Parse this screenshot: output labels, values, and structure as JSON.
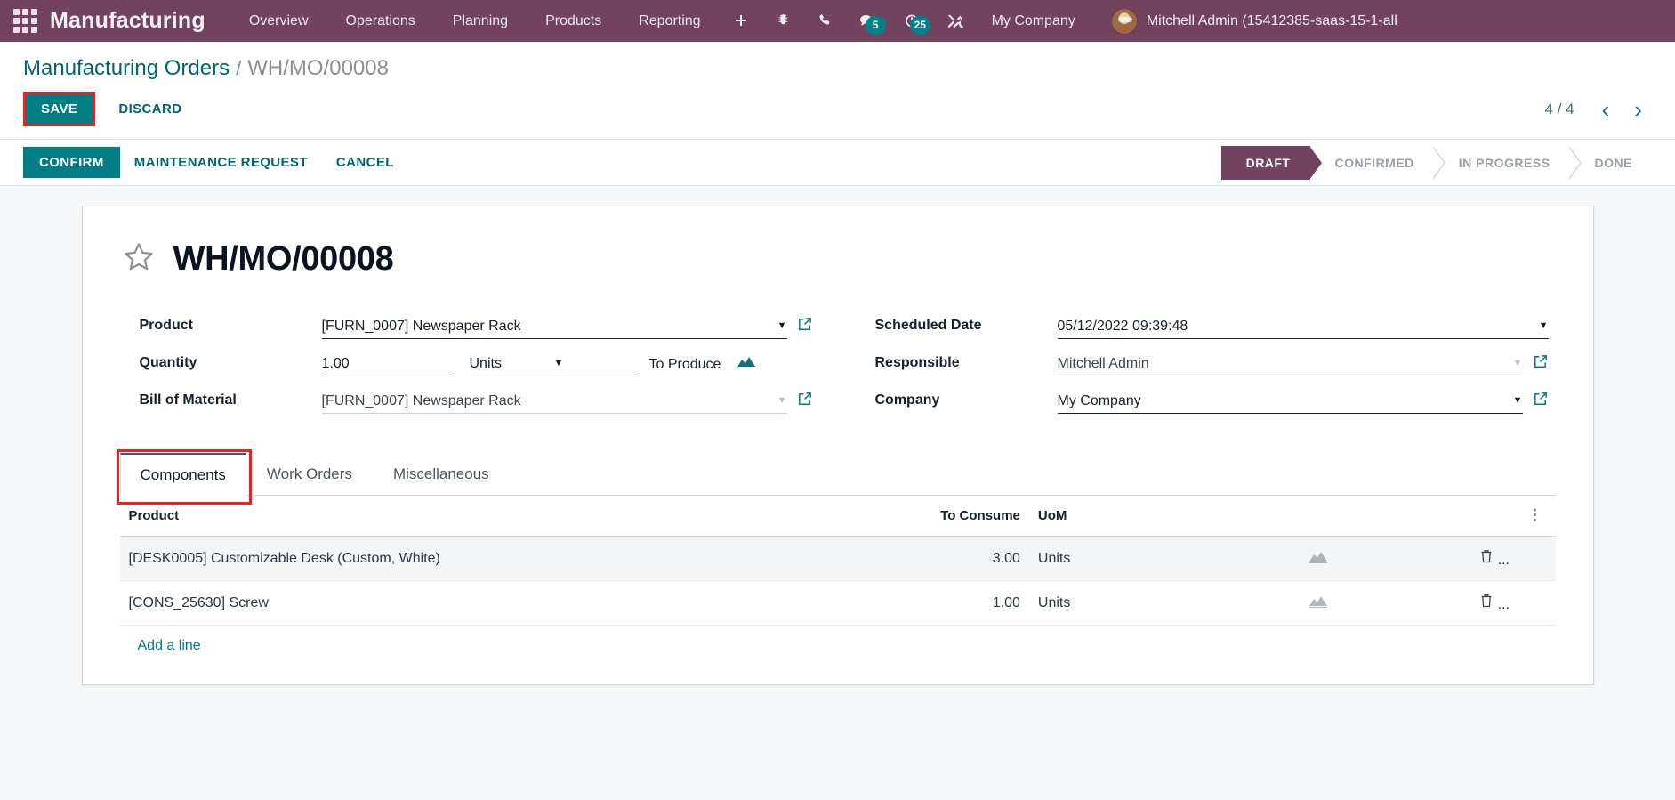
{
  "navbar": {
    "apps_icon": "apps-grid-icon",
    "brand": "Manufacturing",
    "menu": [
      {
        "label": "Overview"
      },
      {
        "label": "Operations"
      },
      {
        "label": "Planning"
      },
      {
        "label": "Products"
      },
      {
        "label": "Reporting"
      }
    ],
    "icons": [
      {
        "name": "plus-icon",
        "glyph": "+"
      },
      {
        "name": "bug-icon",
        "glyph": "bug"
      },
      {
        "name": "phone-icon",
        "glyph": "phone"
      },
      {
        "name": "messages-icon",
        "glyph": "chat",
        "badge": "5"
      },
      {
        "name": "activities-clock-icon",
        "glyph": "clock",
        "badge": "25"
      },
      {
        "name": "tools-icon",
        "glyph": "wrench"
      }
    ],
    "company": "My Company",
    "user": "Mitchell Admin (15412385-saas-15-1-all",
    "brand_color": "#71435f",
    "badge_color": "#00828c"
  },
  "breadcrumb": {
    "root": "Manufacturing Orders",
    "separator": "/",
    "current": "WH/MO/00008"
  },
  "edit_bar": {
    "save_label": "SAVE",
    "discard_label": "DISCARD",
    "save_highlight_color": "#f21f1f",
    "save_bg": "#017e84"
  },
  "pager": {
    "count": "4 / 4",
    "prev": "‹",
    "next": "›"
  },
  "action_bar": {
    "confirm_label": "CONFIRM",
    "maintenance_label": "MAINTENANCE REQUEST",
    "cancel_label": "CANCEL"
  },
  "statusbar": {
    "stages": [
      {
        "label": "DRAFT",
        "active": true
      },
      {
        "label": "CONFIRMED",
        "active": false
      },
      {
        "label": "IN PROGRESS",
        "active": false
      },
      {
        "label": "DONE",
        "active": false
      }
    ],
    "active_color": "#71435f"
  },
  "form": {
    "title": "WH/MO/00008",
    "star_icon": "star-outline-icon",
    "left": {
      "product_label": "Product",
      "product_value": "[FURN_0007] Newspaper Rack",
      "quantity_label": "Quantity",
      "quantity_value": "1.00",
      "uom_value": "Units",
      "to_produce_label": "To Produce",
      "bom_label": "Bill of Material",
      "bom_value": "[FURN_0007] Newspaper Rack"
    },
    "right": {
      "scheduled_label": "Scheduled Date",
      "scheduled_value": "05/12/2022 09:39:48",
      "responsible_label": "Responsible",
      "responsible_value": "Mitchell Admin",
      "company_label": "Company",
      "company_value": "My Company"
    }
  },
  "notebook": {
    "tabs": [
      {
        "label": "Components",
        "active": true
      },
      {
        "label": "Work Orders",
        "active": false
      },
      {
        "label": "Miscellaneous",
        "active": false
      }
    ],
    "highlight_color": "#f21f1f"
  },
  "components_table": {
    "headers": {
      "product": "Product",
      "to_consume": "To Consume",
      "uom": "UoM"
    },
    "options_icon": "vertical-dots-icon",
    "rows": [
      {
        "product": "[DESK0005] Customizable Desk (Custom, White)",
        "to_consume": "3.00",
        "uom": "Units",
        "graph_icon": "area-chart-icon",
        "delete_icon": "trash-icon",
        "delete_suffix": "..."
      },
      {
        "product": "[CONS_25630] Screw",
        "to_consume": "1.00",
        "uom": "Units",
        "graph_icon": "area-chart-icon",
        "delete_icon": "trash-icon",
        "delete_suffix": "..."
      }
    ],
    "add_line_label": "Add a line"
  }
}
